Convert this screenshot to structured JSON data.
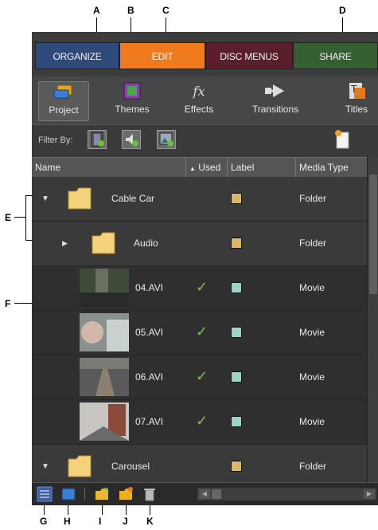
{
  "callouts": {
    "A": "A",
    "B": "B",
    "C": "C",
    "D": "D",
    "E": "E",
    "F": "F",
    "G": "G",
    "H": "H",
    "I": "I",
    "J": "J",
    "K": "K"
  },
  "tabs": [
    "ORGANIZE",
    "EDIT",
    "DISC MENUS",
    "SHARE"
  ],
  "categories": [
    "Project",
    "Themes",
    "Effects",
    "Transitions",
    "Titles"
  ],
  "filter": {
    "label": "Filter By:"
  },
  "columns": {
    "name": "Name",
    "used": "Used",
    "label": "Label",
    "media_type": "Media Type"
  },
  "rows": [
    {
      "name": "Cable Car",
      "type": "Folder"
    },
    {
      "name": "Audio",
      "type": "Folder"
    },
    {
      "name": "04.AVI",
      "type": "Movie"
    },
    {
      "name": "05.AVI",
      "type": "Movie"
    },
    {
      "name": "06.AVI",
      "type": "Movie"
    },
    {
      "name": "07.AVI",
      "type": "Movie"
    },
    {
      "name": "Carousel",
      "type": "Folder"
    }
  ],
  "colors": {
    "organize_tab": "#2f4a7a",
    "edit_tab": "#f07a1e",
    "disc_tab": "#5a1f2a",
    "share_tab": "#355f33",
    "folder_label": "#d9b86e",
    "movie_label": "#9fd2c6",
    "used_check": "#7cbf3b"
  },
  "icons": {
    "fx": "fx",
    "check": "✓",
    "sort_up": "▲"
  }
}
